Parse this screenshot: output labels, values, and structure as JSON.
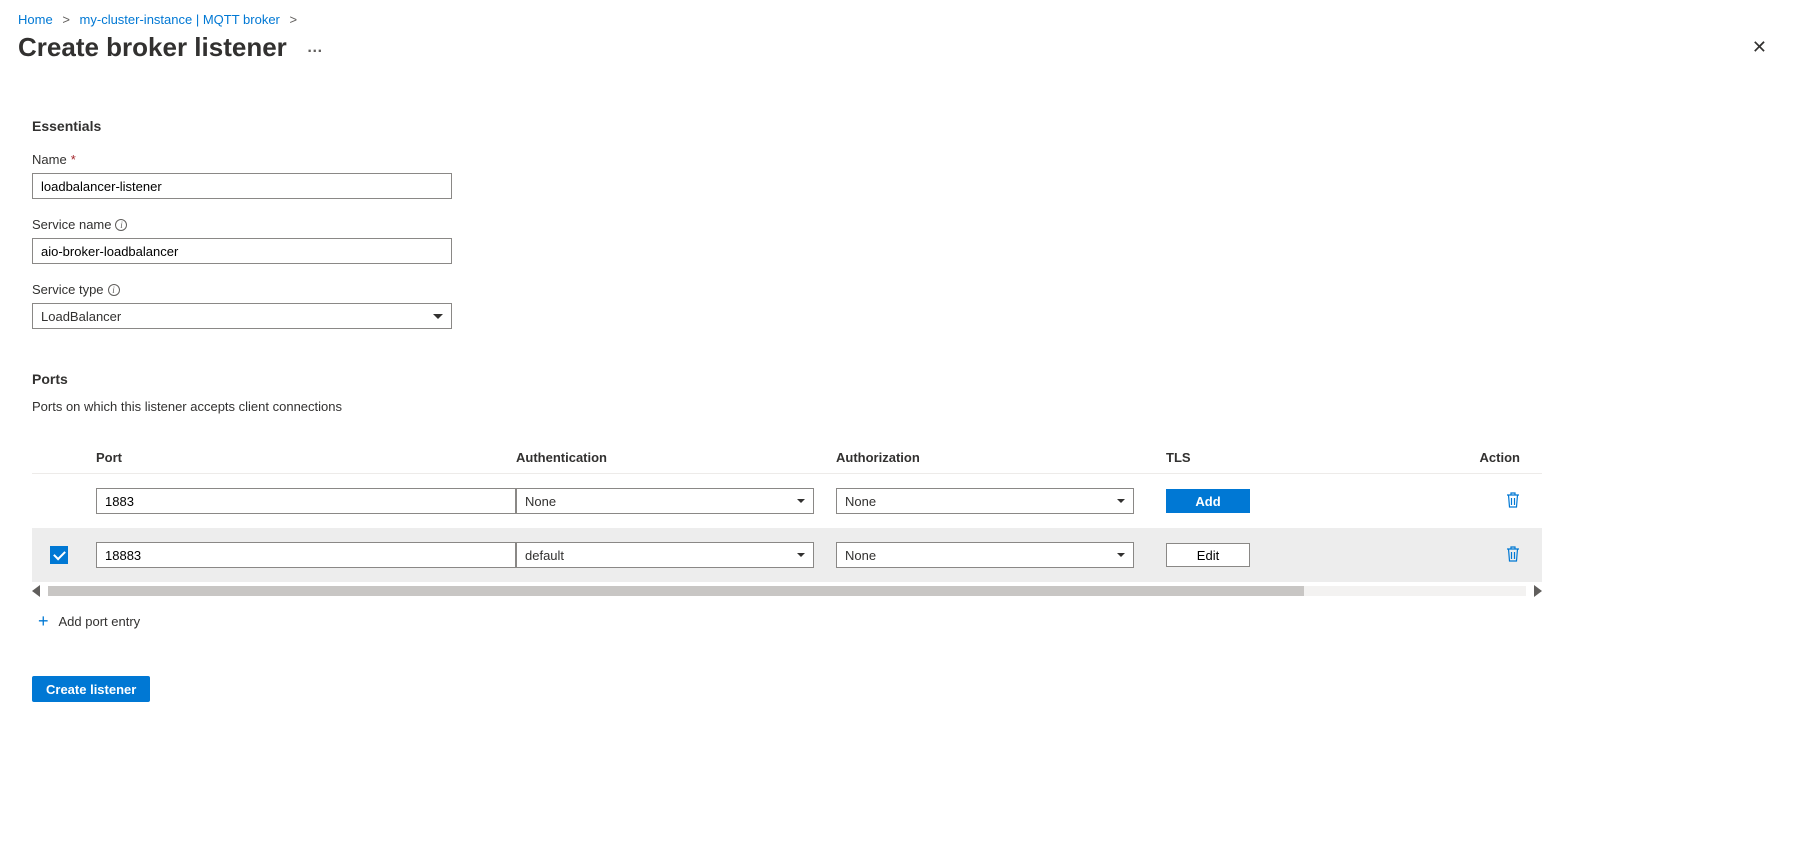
{
  "breadcrumb": {
    "home": "Home",
    "instance": "my-cluster-instance | MQTT broker"
  },
  "header": {
    "title": "Create broker listener",
    "more": "…"
  },
  "essentials": {
    "section_label": "Essentials",
    "name_label": "Name",
    "name_value": "loadbalancer-listener",
    "service_name_label": "Service name",
    "service_name_value": "aio-broker-loadbalancer",
    "service_type_label": "Service type",
    "service_type_value": "LoadBalancer"
  },
  "ports": {
    "section_label": "Ports",
    "description": "Ports on which this listener accepts client connections",
    "columns": {
      "port": "Port",
      "auth": "Authentication",
      "authz": "Authorization",
      "tls": "TLS",
      "action": "Action"
    },
    "rows": [
      {
        "checked": false,
        "port": "1883",
        "auth": "None",
        "authz": "None",
        "tls_label": "Add",
        "tls_primary": true
      },
      {
        "checked": true,
        "port": "18883",
        "auth": "default",
        "authz": "None",
        "tls_label": "Edit",
        "tls_primary": false
      }
    ],
    "add_label": "Add port entry"
  },
  "footer": {
    "create_label": "Create listener"
  }
}
